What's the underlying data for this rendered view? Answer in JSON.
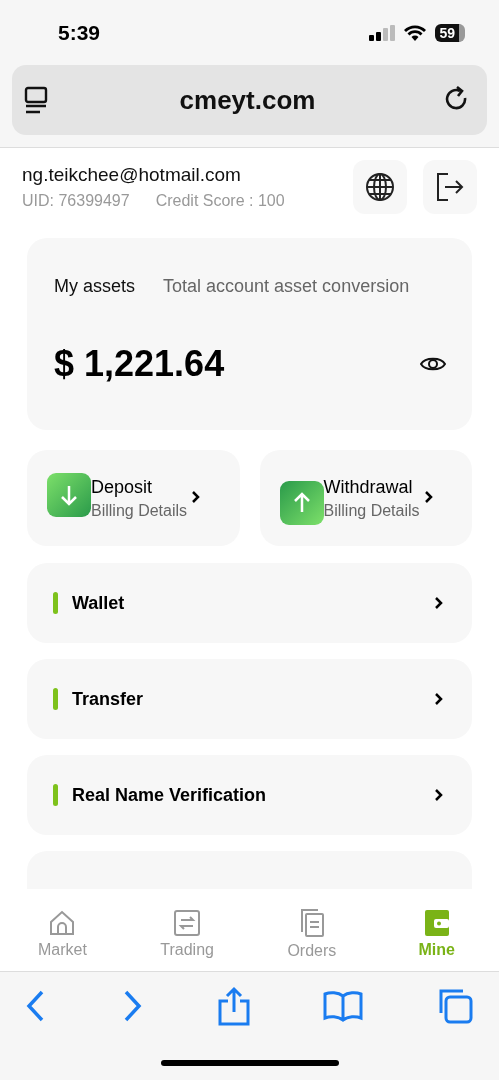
{
  "status_bar": {
    "time": "5:39",
    "battery": "59"
  },
  "browser": {
    "url": "cmeyt.com"
  },
  "user": {
    "email": "ng.teikchee@hotmail.com",
    "uid": "UID: 76399497",
    "credit": "Credit Score : 100"
  },
  "assets": {
    "title": "My assets",
    "subtitle": "Total account asset conversion",
    "amount": "$ 1,221.64"
  },
  "actions": [
    {
      "kind": "deposit",
      "title": "Deposit",
      "subtitle": "Billing Details"
    },
    {
      "kind": "withdrawal",
      "title": "Withdrawal",
      "subtitle": "Billing Details"
    }
  ],
  "menu": [
    "Wallet",
    "Transfer",
    "Real Name Verification"
  ],
  "tabs": [
    {
      "kind": "market",
      "label": "Market",
      "selected": false
    },
    {
      "kind": "trading",
      "label": "Trading",
      "selected": false
    },
    {
      "kind": "orders",
      "label": "Orders",
      "selected": false
    },
    {
      "kind": "mine",
      "label": "Mine",
      "selected": true
    }
  ]
}
